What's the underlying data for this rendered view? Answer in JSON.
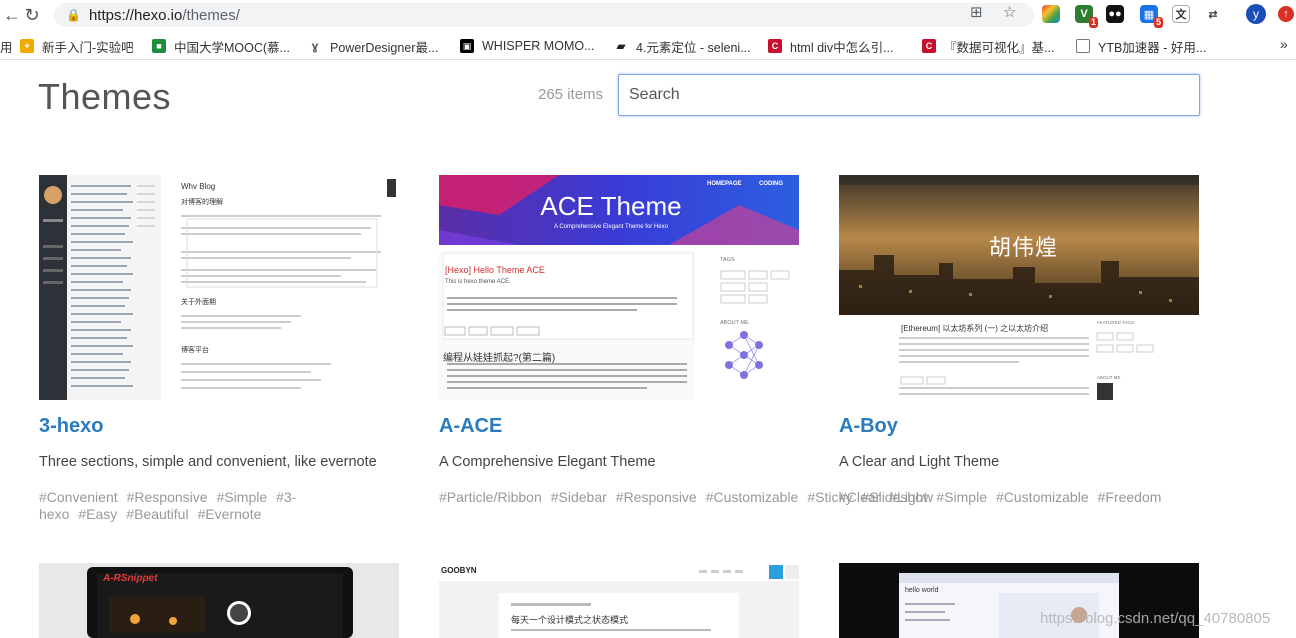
{
  "browser": {
    "url_host": "https://hexo.io",
    "url_path": "/themes/",
    "avatar_letter": "y",
    "ext_badge_1": "1",
    "ext_badge_2": "5",
    "bookmarks": [
      {
        "label": "用",
        "color": "#1a73e8"
      },
      {
        "label": "新手入门-实验吧",
        "color": "#f2a900"
      },
      {
        "label": "中国大学MOOC(慕...",
        "color": "#1e8e3e"
      },
      {
        "label": "PowerDesigner最...",
        "color": "#555555"
      },
      {
        "label": "WHISPER MOMO...",
        "color": "#000000"
      },
      {
        "label": "4.元素定位 - seleni...",
        "color": "#222222"
      },
      {
        "label": "html div中怎么引...",
        "color": "#c8102e"
      },
      {
        "label": "『数据可视化』基...",
        "color": "#c8102e"
      },
      {
        "label": "YTB加速器 - 好用...",
        "color": "#777777"
      }
    ]
  },
  "page": {
    "title": "Themes",
    "count": "265 items",
    "search_placeholder": "Search"
  },
  "themes": [
    {
      "name": "3-hexo",
      "description": "Three sections, simple and convenient, like evernote",
      "tags": [
        "#Convenient",
        "#Responsive",
        "#Simple",
        "#3-hexo",
        "#Easy",
        "#Beautiful",
        "#Evernote"
      ],
      "thumb": {
        "blog_title": "Whv Blog",
        "heading1": "对博客的理解",
        "heading2": "关于外面期",
        "heading3": "博客平台"
      }
    },
    {
      "name": "A-ACE",
      "description": "A Comprehensive Elegant Theme",
      "tags": [
        "#Particle/Ribbon",
        "#Sidebar",
        "#Responsive",
        "#Customizable",
        "#Sticky",
        "#Slideshow"
      ],
      "thumb": {
        "nav1": "HOMEPAGE",
        "nav2": "CODING",
        "banner_title": "ACE Theme",
        "banner_sub": "A Comprehensive Elegant Theme for Hexo",
        "post_title": "[Hexo] Hello Theme ACE",
        "post_line": "This is hexo theme ACE.",
        "post2_title": "编程从娃娃抓起?(第二篇)",
        "side_tags": "TAGS",
        "side_about": "ABOUT ME"
      }
    },
    {
      "name": "A-Boy",
      "description": "A Clear and Light Theme",
      "tags": [
        "#Clear",
        "#Light",
        "#Simple",
        "#Customizable",
        "#Freedom"
      ],
      "thumb": {
        "hero_title": "胡伟煌",
        "post_title": "[Ethereum] 以太坊系列 (一) 之以太坊介绍",
        "side_featured": "FEATURED TAGS",
        "side_about": "ABOUT ME"
      }
    }
  ],
  "row2": {
    "thumb1_title": "A-RSnippet",
    "thumb2_logo": "GOOBYN",
    "thumb2_heading": "每天一个设计模式之状态模式",
    "thumb3_line": "hello world"
  },
  "watermark": "https://blog.csdn.net/qq_40780805"
}
